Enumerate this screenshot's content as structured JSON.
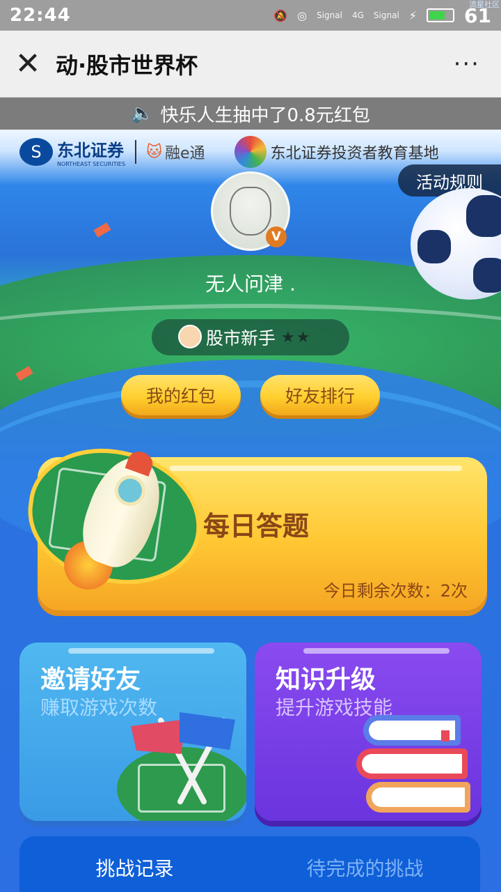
{
  "status_bar": {
    "time": "22:44",
    "signal_label_1": "Signal",
    "network": "4G",
    "signal_label_2": "Signal",
    "battery": "61",
    "corner_text": "流星社区"
  },
  "header": {
    "close_icon": "close-icon",
    "title": "动·股市世界杯",
    "more": "···"
  },
  "ticker": {
    "text": "快乐人生抽中了0.8元红包"
  },
  "logos": {
    "northeast_cn": "东北证券",
    "northeast_en": "NORTHEAST SECURITIES",
    "rongetong": "融e通",
    "edu_base": "东北证券投资者教育基地"
  },
  "rules_button": "活动规则",
  "profile": {
    "username": "无人问津 .",
    "level": "股市新手",
    "stars": "★★"
  },
  "buttons": {
    "red_packet": "我的红包",
    "friend_rank": "好友排行"
  },
  "quiz": {
    "title": "每日答题",
    "remaining": "今日剩余次数：2次"
  },
  "invite": {
    "title": "邀请好友",
    "subtitle": "赚取游戏次数"
  },
  "upgrade": {
    "title": "知识升级",
    "subtitle": "提升游戏技能"
  },
  "tabs": {
    "records": "挑战记录",
    "pending": "待完成的挑战"
  },
  "colors": {
    "gold": "#ffcf2f",
    "invite_card": "#3a9be6",
    "upgrade_card": "#6a34de",
    "tab_bar": "#0e5fd8"
  }
}
